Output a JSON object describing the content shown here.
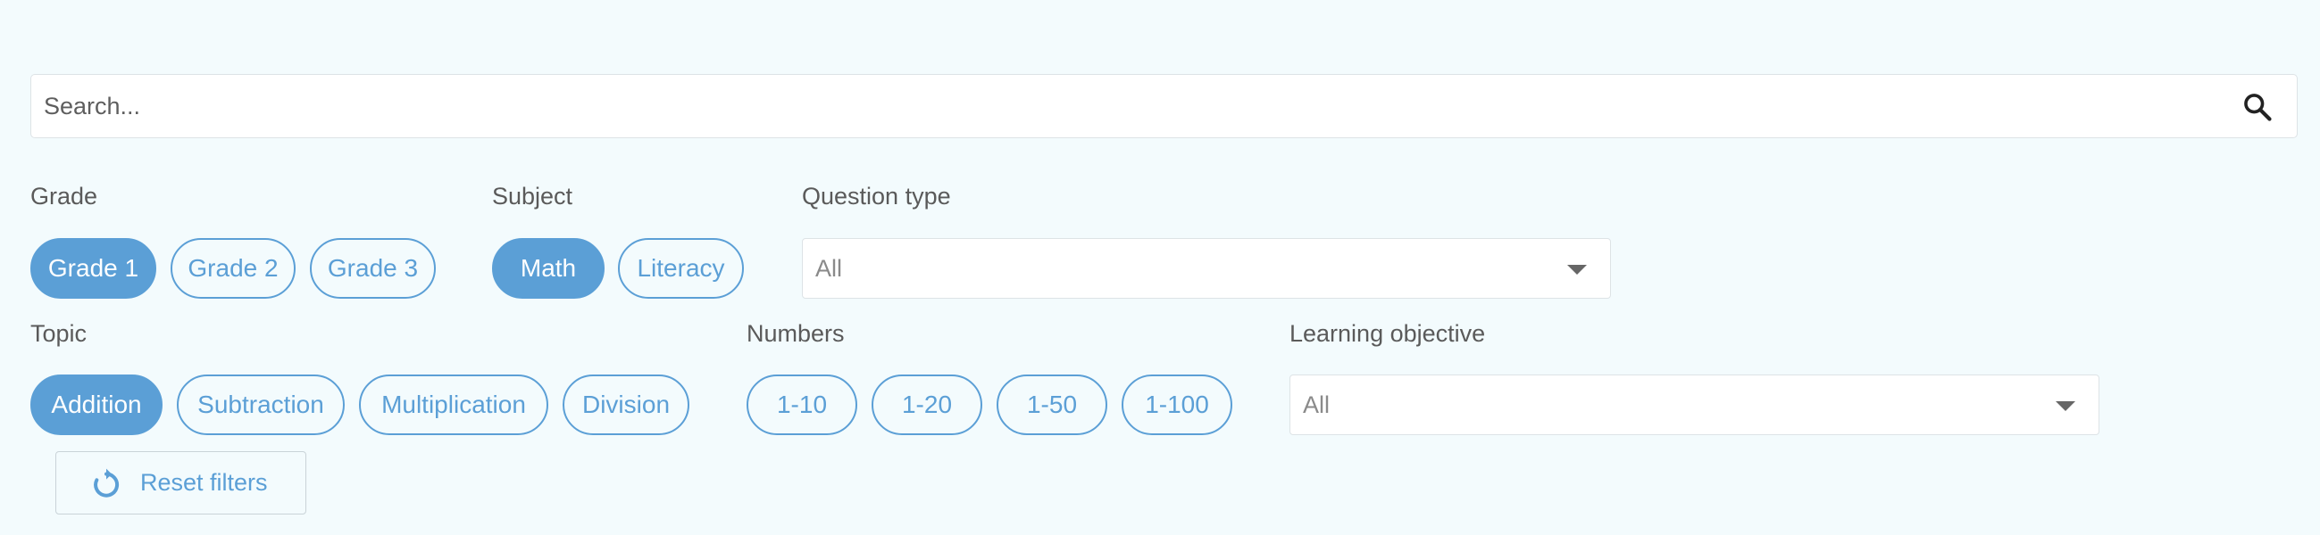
{
  "search": {
    "placeholder": "Search..."
  },
  "filters": {
    "grade": {
      "label": "Grade",
      "options": [
        "Grade 1",
        "Grade 2",
        "Grade 3"
      ],
      "selected": "Grade 1"
    },
    "subject": {
      "label": "Subject",
      "options": [
        "Math",
        "Literacy"
      ],
      "selected": "Math"
    },
    "question_type": {
      "label": "Question type",
      "value": "All"
    },
    "topic": {
      "label": "Topic",
      "options": [
        "Addition",
        "Subtraction",
        "Multiplication",
        "Division"
      ],
      "selected": "Addition"
    },
    "numbers": {
      "label": "Numbers",
      "options": [
        "1-10",
        "1-20",
        "1-50",
        "1-100"
      ]
    },
    "learning_objective": {
      "label": "Learning objective",
      "value": "All"
    }
  },
  "reset": {
    "label": "Reset filters"
  },
  "colors": {
    "accent": "#5b9fd6",
    "background": "#f3fbfd"
  }
}
